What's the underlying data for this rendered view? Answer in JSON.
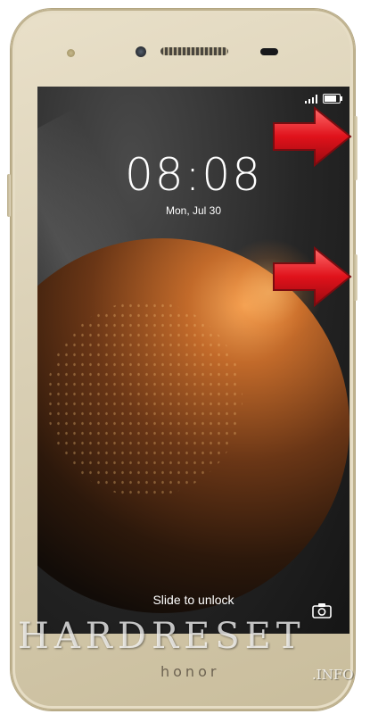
{
  "lockscreen": {
    "time": "08:08",
    "date": "Mon, Jul 30",
    "slide_hint": "Slide to unlock",
    "battery_level": 0.8,
    "signal_bars": 4
  },
  "device": {
    "brand_label": "honor"
  },
  "watermark": {
    "text": "HARDRESET",
    "sub": ".INFO"
  },
  "icons": {
    "camera": "camera-icon",
    "signal": "signal-icon",
    "battery": "battery-icon",
    "arrows": "arrow-right-icon"
  },
  "colors": {
    "phone_body": "#d9cfb4",
    "arrow_red": "#e0121b",
    "screen_text": "#ffffff"
  }
}
